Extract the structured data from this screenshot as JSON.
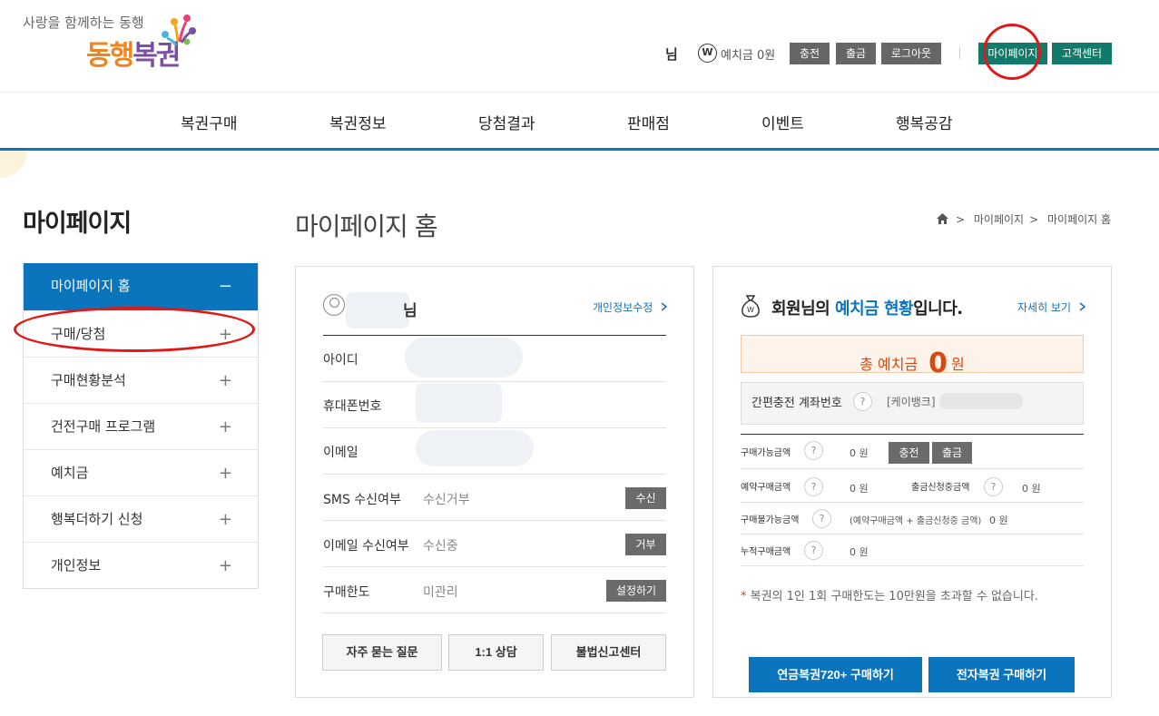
{
  "header": {
    "tagline": "사랑을 함께하는 동행",
    "logo_part1": "동행",
    "logo_part2": "복권",
    "user_suffix": "님",
    "won_symbol": "W",
    "deposit": "예치금 0원",
    "buttons": {
      "charge": "충전",
      "withdraw": "출금",
      "logout": "로그아웃",
      "mypage": "마이페이지",
      "support": "고객센터"
    }
  },
  "gnb": [
    "복권구매",
    "복권정보",
    "당첨결과",
    "판매점",
    "이벤트",
    "행복공감"
  ],
  "sidebar": {
    "title": "마이페이지",
    "items": [
      {
        "label": "마이페이지 홈",
        "sign": "−"
      },
      {
        "label": "구매/당첨",
        "sign": "+"
      },
      {
        "label": "구매현황분석",
        "sign": "+"
      },
      {
        "label": "건전구매 프로그램",
        "sign": "+"
      },
      {
        "label": "예치금",
        "sign": "+"
      },
      {
        "label": "행복더하기 신청",
        "sign": "+"
      },
      {
        "label": "개인정보",
        "sign": "+"
      }
    ]
  },
  "main": {
    "title": "마이페이지 홈",
    "breadcrumb": [
      "마이페이지",
      "마이페이지 홈"
    ],
    "breadcrumb_sep": ">"
  },
  "profile": {
    "name_suffix": "님",
    "edit_link": "개인정보수정",
    "rows": {
      "id": {
        "label": "아이디"
      },
      "phone": {
        "label": "휴대폰번호"
      },
      "email": {
        "label": "이메일"
      },
      "sms": {
        "label": "SMS 수신여부",
        "value": "수신거부",
        "btn": "수신"
      },
      "email_recv": {
        "label": "이메일 수신여부",
        "value": "수신중",
        "btn": "거부"
      },
      "limit": {
        "label": "구매한도",
        "value": "미관리",
        "btn": "설정하기"
      }
    },
    "buttons": {
      "faq": "자주 묻는 질문",
      "consult": "1:1 상담",
      "report": "불법신고센터"
    }
  },
  "deposit_panel": {
    "title_pre": "회원님의 ",
    "title_hl": "예치금 현황",
    "title_post": "입니다.",
    "detail_link": "자세히 보기",
    "total_label": "총 예치금",
    "total_value": "0",
    "total_unit": "원",
    "account_label": "간편충전 계좌번호",
    "account_bank": "[케이뱅크]",
    "q": "?",
    "rows": {
      "available": {
        "label": "구매가능금액",
        "value": "0 원"
      },
      "reserved": {
        "label": "예약구매금액",
        "value": "0 원"
      },
      "withdraw_req": {
        "label": "출금신청중금액",
        "value": "0 원"
      },
      "unavailable": {
        "label": "구매불가능금액",
        "formula": "(예약구매금액 + 출금신청중 금액)",
        "value": "0 원"
      },
      "cumulative": {
        "label": "누적구매금액",
        "value": "0 원"
      }
    },
    "charge_btn": "충전",
    "withdraw_btn": "출금",
    "notice": "복권의 1인 1회 구매한도는 10만원을 초과할 수 없습니다.",
    "notice_mark": "*",
    "buy_720": "연금복권720+ 구매하기",
    "buy_e": "전자복권 구매하기"
  },
  "colors": {
    "primary": "#0a74bd",
    "teal": "#127a6a",
    "orange": "#d9480f",
    "annotation": "#e01818"
  }
}
